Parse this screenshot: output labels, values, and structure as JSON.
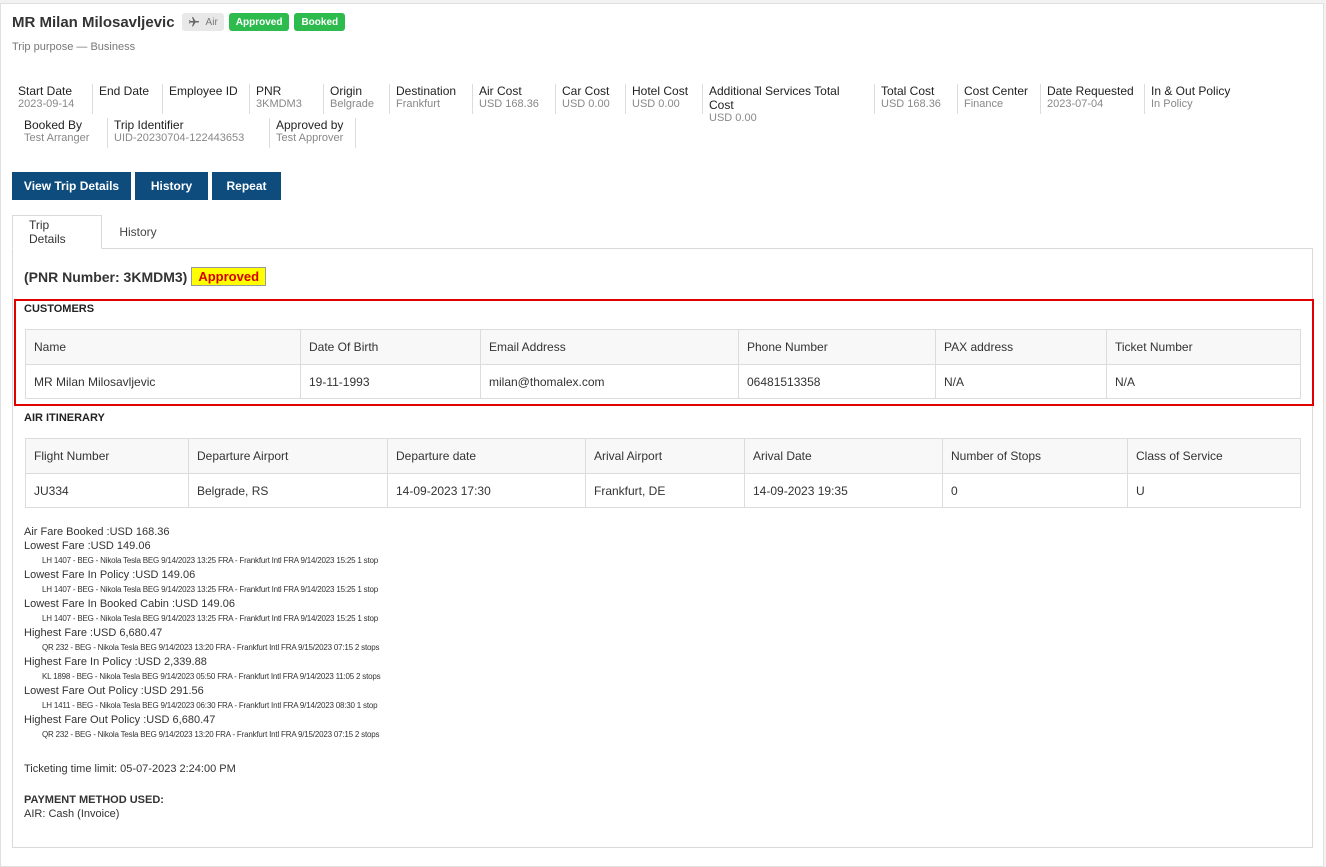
{
  "header": {
    "title": "MR Milan Milosavljevic",
    "type_badge": "Air",
    "status_badges": [
      "Approved",
      "Booked"
    ],
    "subtitle": "Trip purpose — Business"
  },
  "info_fields": [
    {
      "label": "Start Date",
      "value": "2023-09-14"
    },
    {
      "label": "End Date",
      "value": ""
    },
    {
      "label": "Employee ID",
      "value": ""
    },
    {
      "label": "PNR",
      "value": "3KMDM3"
    },
    {
      "label": "Origin",
      "value": "Belgrade"
    },
    {
      "label": "Destination",
      "value": "Frankfurt"
    },
    {
      "label": "Air Cost",
      "value": "USD 168.36"
    },
    {
      "label": "Car Cost",
      "value": "USD 0.00"
    },
    {
      "label": "Hotel Cost",
      "value": "USD 0.00"
    },
    {
      "label": "Additional Services Total Cost",
      "value": "USD 0.00"
    },
    {
      "label": "Total Cost",
      "value": "USD 168.36"
    },
    {
      "label": "Cost Center",
      "value": "Finance"
    },
    {
      "label": "Date Requested",
      "value": "2023-07-04"
    },
    {
      "label": "In & Out Policy",
      "value": "In Policy"
    },
    {
      "label": "Booked By",
      "value": "Test Arranger"
    },
    {
      "label": "Trip Identifier",
      "value": "UID-20230704-122443653"
    },
    {
      "label": "Approved by",
      "value": "Test Approver"
    }
  ],
  "buttons": {
    "view_trip_details": "View Trip Details",
    "history": "History",
    "repeat": "Repeat"
  },
  "tabs": {
    "trip_details": "Trip Details",
    "history": "History"
  },
  "pnr": {
    "label": "(PNR Number: 3KMDM3)",
    "status": "Approved"
  },
  "customers": {
    "title": "CUSTOMERS",
    "columns": [
      "Name",
      "Date Of Birth",
      "Email Address",
      "Phone Number",
      "PAX address",
      "Ticket Number"
    ],
    "rows": [
      [
        "MR Milan Milosavljevic",
        "19-11-1993",
        "milan@thomalex.com",
        "06481513358",
        "N/A",
        "N/A"
      ]
    ]
  },
  "air_itinerary": {
    "title": "AIR ITINERARY",
    "columns": [
      "Flight Number",
      "Departure Airport",
      "Departure date",
      "Arival Airport",
      "Arival Date",
      "Number of Stops",
      "Class of Service"
    ],
    "rows": [
      [
        "JU334",
        "Belgrade, RS",
        "14-09-2023 17:30",
        "Frankfurt, DE",
        "14-09-2023 19:35",
        "0",
        "U"
      ]
    ]
  },
  "fares": [
    {
      "label": "Air Fare Booked :",
      "value": "USD 168.36",
      "detail": ""
    },
    {
      "label": "Lowest Fare :",
      "value": "USD 149.06",
      "detail": "LH 1407 - BEG - Nikola Tesla BEG 9/14/2023 13:25 FRA - Frankfurt Intl FRA 9/14/2023 15:25 1 stop"
    },
    {
      "label": "Lowest Fare In Policy :",
      "value": "USD 149.06",
      "detail": "LH 1407 - BEG - Nikola Tesla BEG 9/14/2023 13:25 FRA - Frankfurt Intl FRA 9/14/2023 15:25 1 stop"
    },
    {
      "label": "Lowest Fare In Booked Cabin :",
      "value": "USD 149.06",
      "detail": "LH 1407 - BEG - Nikola Tesla BEG 9/14/2023 13:25 FRA - Frankfurt Intl FRA 9/14/2023 15:25 1 stop"
    },
    {
      "label": "Highest Fare :",
      "value": "USD 6,680.47",
      "detail": "QR 232 - BEG - Nikola Tesla BEG 9/14/2023 13:20 FRA - Frankfurt Intl FRA 9/15/2023 07:15 2 stops"
    },
    {
      "label": "Highest Fare In Policy :",
      "value": "USD 2,339.88",
      "detail": "KL 1898 - BEG - Nikola Tesla BEG 9/14/2023 05:50 FRA - Frankfurt Intl FRA 9/14/2023 11:05 2 stops"
    },
    {
      "label": "Lowest Fare Out Policy :",
      "value": "USD 291.56",
      "detail": "LH 1411 - BEG - Nikola Tesla BEG 9/14/2023 06:30 FRA - Frankfurt Intl FRA 9/14/2023 08:30 1 stop"
    },
    {
      "label": "Highest Fare Out Policy :",
      "value": "USD 6,680.47",
      "detail": "QR 232 - BEG - Nikola Tesla BEG 9/14/2023 13:20 FRA - Frankfurt Intl FRA 9/15/2023 07:15 2 stops"
    }
  ],
  "ticketing": "Ticketing time limit: 05-07-2023 2:24:00 PM",
  "payment": {
    "title": "PAYMENT METHOD USED:",
    "value": "AIR: Cash (Invoice)"
  },
  "colors": {
    "primary_button": "#0e4c7e",
    "badge_green": "#2dbb4e",
    "highlight_red": "#e00000",
    "approved_yellow": "#ffff00"
  }
}
